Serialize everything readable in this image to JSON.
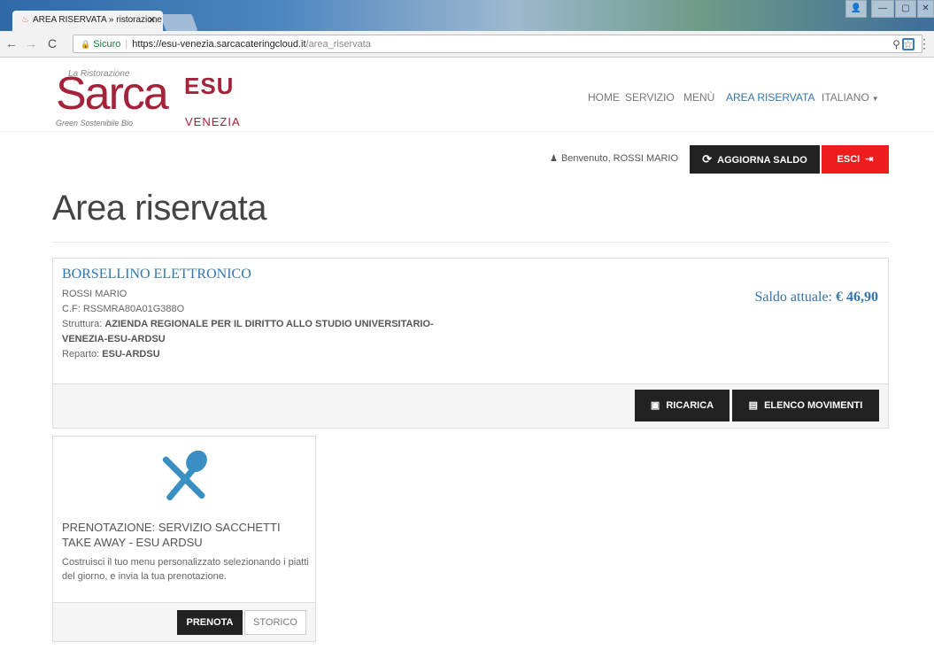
{
  "browser": {
    "tab_title": "AREA RISERVATA » ristorazione",
    "secure_label": "Sicuro",
    "url_host": "https://esu-venezia.sarcacateringcloud.it",
    "url_path": "/area_riservata"
  },
  "logo": {
    "brand": "Sarca",
    "tagline_top": "La Ristorazione",
    "tagline_bottom": "Green Sostenibile Bio",
    "partner": "ESU",
    "city": "VENEZIA"
  },
  "nav": {
    "home": "HOME",
    "servizio": "SERVIZIO",
    "menu": "MENÙ",
    "area": "AREA RISERVATA",
    "language": "ITALIANO"
  },
  "userbar": {
    "welcome": "Benvenuto, ROSSI MARIO",
    "refresh_label": "AGGIORNA SALDO",
    "logout_label": "ESCI"
  },
  "page": {
    "title": "Area riservata"
  },
  "wallet": {
    "title": "BORSELLINO ELETTRONICO",
    "name": "ROSSI MARIO",
    "cf": "C.F: RSSMRA80A01G388O",
    "struttura_label": "Struttura:",
    "struttura_line1": "AZIENDA REGIONALE PER IL DIRITTO ALLO STUDIO UNIVERSITARIO-",
    "struttura_line2": "VENEZIA-ESU-ARDSU",
    "reparto_label": "Reparto:",
    "reparto": "ESU-ARDSU",
    "balance_label": "Saldo attuale:",
    "balance": "€ 46,90",
    "recharge_label": "RICARICA",
    "movements_label": "ELENCO MOVIMENTI"
  },
  "service": {
    "title": "PRENOTAZIONE: SERVIZIO SACCHETTI TAKE AWAY - ESU ARDSU",
    "description": "Costruisci il tuo menu personalizzato selezionando i piatti del giorno, e invia la tua prenotazione.",
    "book_label": "PRENOTA",
    "history_label": "STORICO",
    "icon_color": "#3a8fc2"
  }
}
